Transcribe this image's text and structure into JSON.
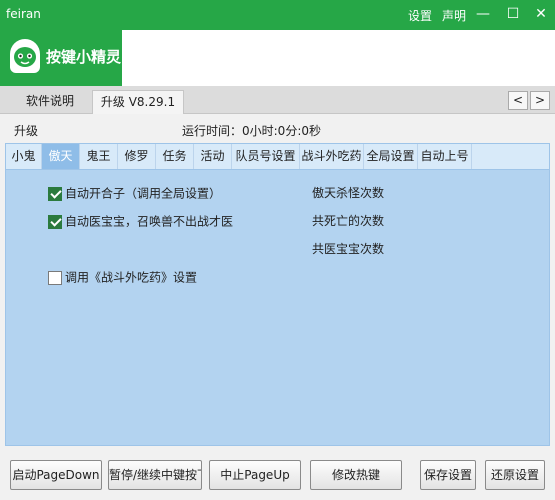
{
  "window": {
    "app_name": "feiran",
    "settings_link": "设置",
    "statement_link": "声明",
    "minimize": "—",
    "maximize": "☐",
    "close": "✕"
  },
  "header": {
    "logo_text": "按键小精灵"
  },
  "outer_tabs": [
    {
      "label": "软件说明",
      "active": false
    },
    {
      "label": "升级 V8.29.1",
      "active": true
    }
  ],
  "nav": {
    "prev": "<",
    "next": ">"
  },
  "status": {
    "label": "升级",
    "runtime": "运行时间：0小时:0分:0秒"
  },
  "inner_tabs": [
    {
      "label": "小鬼",
      "active": false
    },
    {
      "label": "傲天",
      "active": true
    },
    {
      "label": "鬼王",
      "active": false
    },
    {
      "label": "修罗",
      "active": false
    },
    {
      "label": "任务",
      "active": false
    },
    {
      "label": "活动",
      "active": false
    },
    {
      "label": "队员号设置",
      "active": false
    },
    {
      "label": "战斗外吃药",
      "active": false
    },
    {
      "label": "全局设置",
      "active": false
    },
    {
      "label": "自动上号",
      "active": false
    }
  ],
  "options": [
    {
      "label": "自动开合子（调用全局设置）",
      "checked": true
    },
    {
      "label": "自动医宝宝，召唤兽不出战才医",
      "checked": true
    },
    {
      "label": "调用《战斗外吃药》设置",
      "checked": false
    }
  ],
  "stats": [
    "傲天杀怪次数",
    "共死亡的次数",
    "共医宝宝次数"
  ],
  "buttons": {
    "start": "启动PageDown",
    "pause": "暂停/继续中键按下",
    "stop": "中止PageUp",
    "hotkey": "修改热键",
    "save": "保存设置",
    "restore": "还原设置"
  },
  "colors": {
    "brand_green": "#26a747",
    "tab_active_blue": "#8fbde8",
    "panel_blue": "#b3d3f0",
    "check_green": "#2b7a3e"
  }
}
